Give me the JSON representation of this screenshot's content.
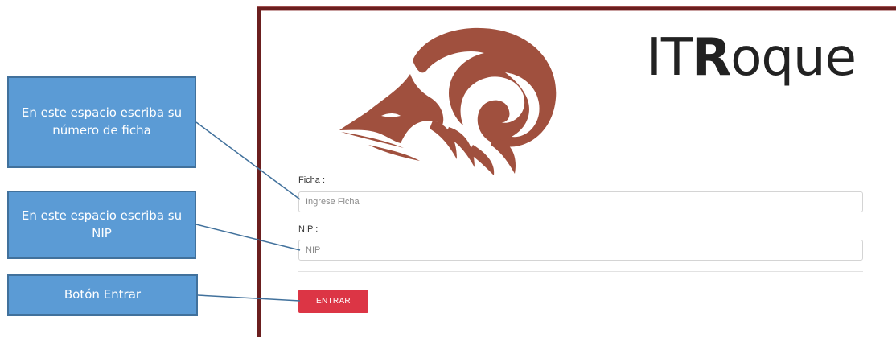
{
  "brand": {
    "prefix": "IT",
    "bold": "R",
    "suffix": "oque",
    "logo_icon": "ram-head-icon"
  },
  "form": {
    "ficha": {
      "label": "Ficha :",
      "placeholder": "Ingrese Ficha"
    },
    "nip": {
      "label": "NIP :",
      "placeholder": "NIP"
    },
    "submit_label": "ENTRAR"
  },
  "callouts": {
    "ficha": "En este espacio escriba su número de ficha",
    "nip": "En este espacio escriba su NIP",
    "button": "Botón Entrar"
  },
  "colors": {
    "panel_border": "#6b1f1f",
    "logo": "#a0503e",
    "button": "#dc3545",
    "callout_fill": "#5b9bd5",
    "callout_border": "#41719c"
  }
}
